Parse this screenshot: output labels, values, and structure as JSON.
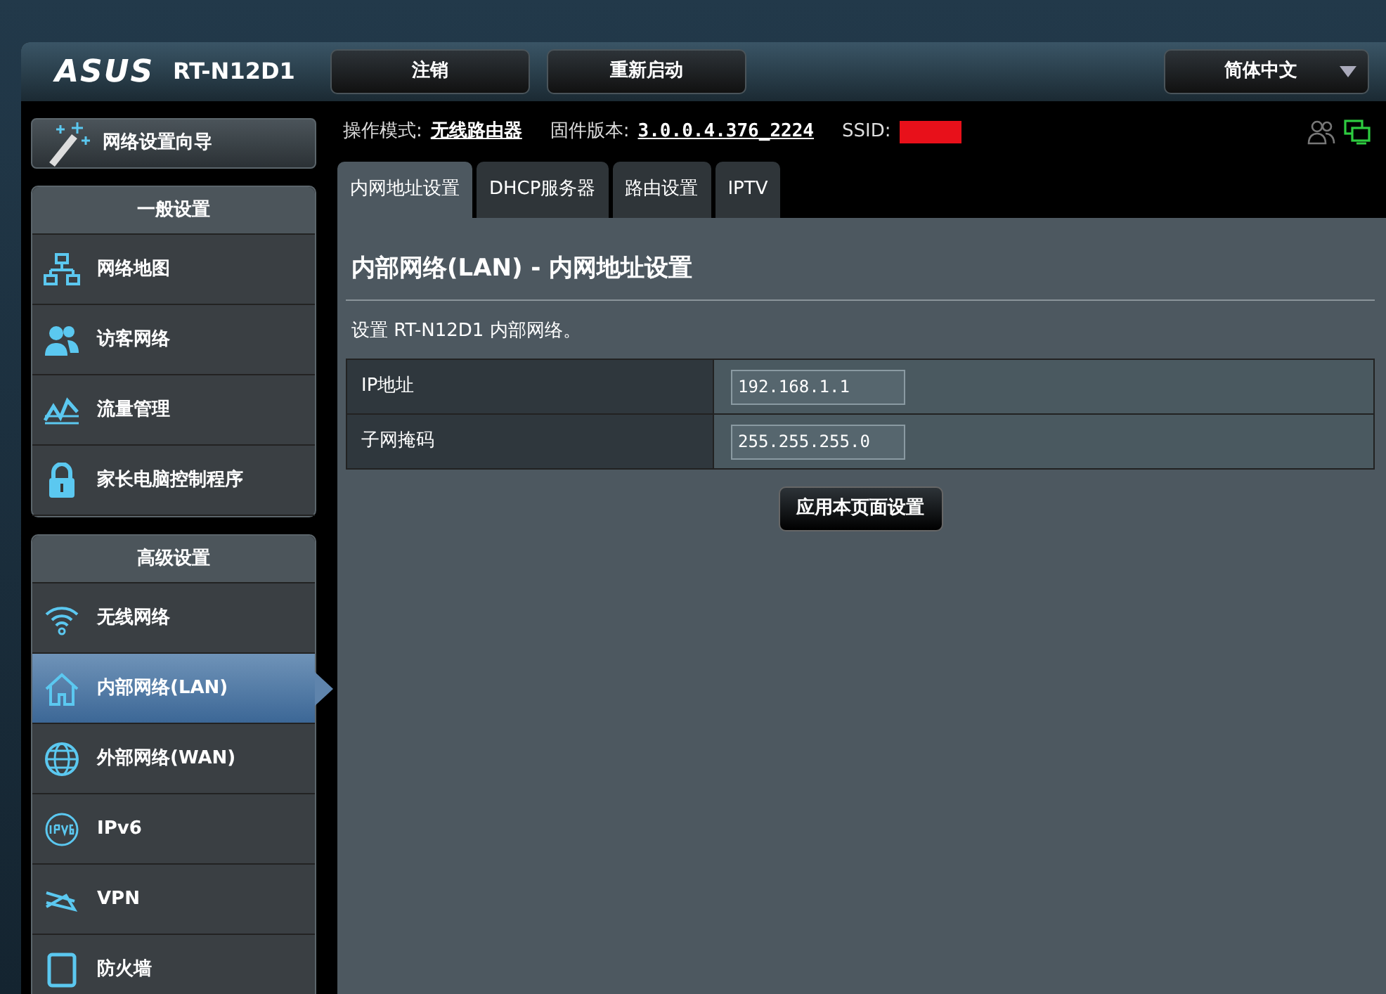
{
  "header": {
    "logo": "ASUS",
    "model": "RT-N12D1",
    "buttons": [
      "注销",
      "重新启动"
    ],
    "language": "简体中文"
  },
  "status": {
    "mode_label": "操作模式:",
    "mode": "无线路由器",
    "firmware_label": "固件版本:",
    "firmware": "3.0.0.4.376_2224",
    "ssid_label": "SSID:"
  },
  "sidebar": {
    "wizard": "网络设置向导",
    "groups": [
      {
        "title": "一般设置",
        "items": [
          {
            "label": "网络地图",
            "selected": false
          },
          {
            "label": "访客网络",
            "selected": false
          },
          {
            "label": "流量管理",
            "selected": false
          },
          {
            "label": "家长电脑控制程序",
            "selected": false
          }
        ]
      },
      {
        "title": "高级设置",
        "items": [
          {
            "label": "无线网络",
            "selected": false
          },
          {
            "label": "内部网络(LAN)",
            "selected": true
          },
          {
            "label": "外部网络(WAN)",
            "selected": false
          },
          {
            "label": "IPv6",
            "selected": false
          },
          {
            "label": "VPN",
            "selected": false
          },
          {
            "label": "防火墙",
            "selected": false
          }
        ]
      }
    ]
  },
  "tabs": [
    {
      "label": "内网地址设置",
      "selected": true
    },
    {
      "label": "DHCP服务器",
      "selected": false
    },
    {
      "label": "路由设置",
      "selected": false
    },
    {
      "label": "IPTV",
      "selected": false
    }
  ],
  "panel": {
    "title": "内部网络(LAN) - 内网地址设置",
    "description": "设置 RT-N12D1 内部网络。",
    "fields": [
      {
        "label": "IP地址",
        "value": "192.168.1.1"
      },
      {
        "label": "子网掩码",
        "value": "255.255.255.0"
      }
    ],
    "apply_button": "应用本页面设置"
  }
}
